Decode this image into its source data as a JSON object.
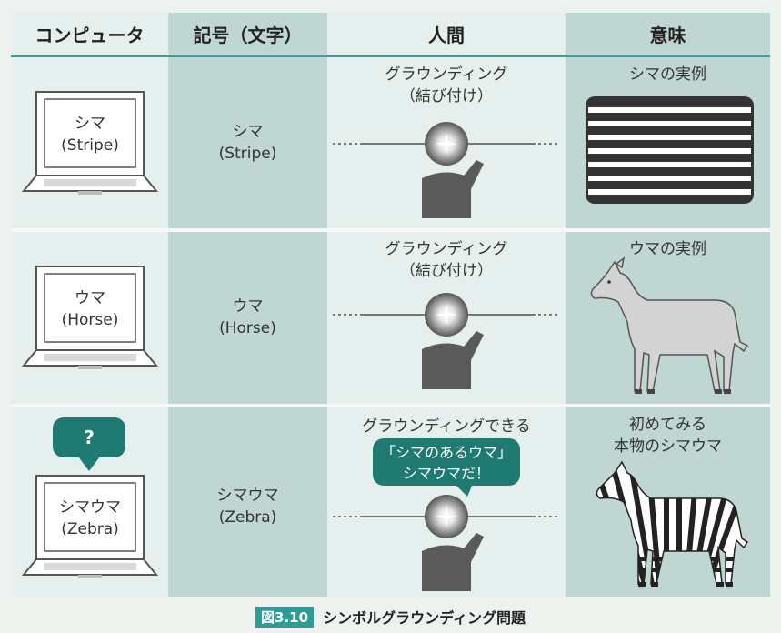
{
  "headers": {
    "computer": "コンピュータ",
    "symbol": "記号（文字）",
    "human": "人間",
    "meaning": "意味"
  },
  "rows": [
    {
      "computer_line1": "シマ",
      "computer_line2": "(Stripe)",
      "symbol_line1": "シマ",
      "symbol_line2": "(Stripe)",
      "human_line1": "グラウンディング",
      "human_line2": "（結び付け）",
      "meaning_line1": "シマの実例"
    },
    {
      "computer_line1": "ウマ",
      "computer_line2": "(Horse)",
      "symbol_line1": "ウマ",
      "symbol_line2": "(Horse)",
      "human_line1": "グラウンディング",
      "human_line2": "（結び付け）",
      "meaning_line1": "ウマの実例"
    },
    {
      "computer_line1": "シマウマ",
      "computer_line2": "(Zebra)",
      "computer_bubble": "?",
      "symbol_line1": "シマウマ",
      "symbol_line2": "(Zebra)",
      "human_line1": "グラウンディングできる",
      "human_bubble_line1": "「シマのあるウマ」",
      "human_bubble_line2": "シマウマだ！",
      "meaning_line1": "初めてみる",
      "meaning_line2": "本物のシマウマ"
    }
  ],
  "caption": {
    "figure_number": "図3.10",
    "title": "シンボルグラウンディング問題"
  },
  "colors": {
    "column_dark": "#bfd6d3",
    "column_light": "#e5efed",
    "accent": "#3e9d99",
    "bubble": "#1f7a72"
  }
}
